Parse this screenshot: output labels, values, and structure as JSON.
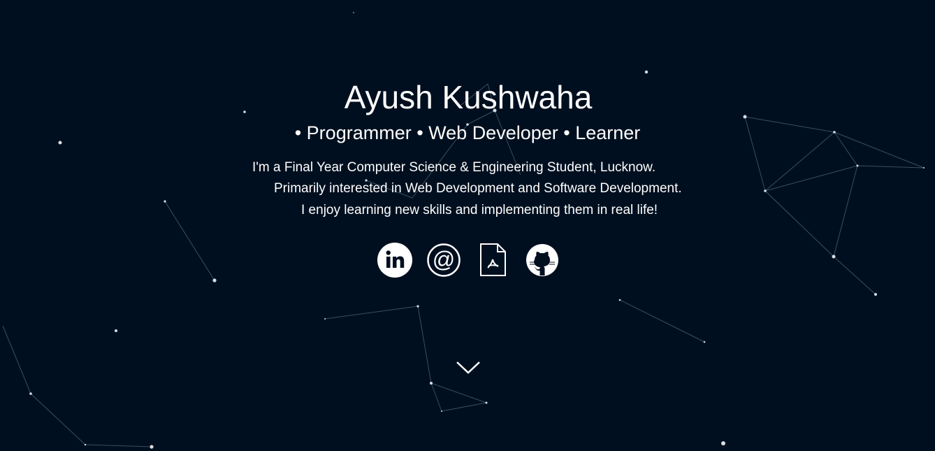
{
  "hero": {
    "name": "Ayush Kushwaha",
    "roles": "• Programmer • Web Developer • Learner",
    "bio": [
      "I'm a Final Year Computer Science & Engineering Student, Lucknow.",
      "Primarily interested in Web Development and Software Development.",
      "I enjoy learning new skills and implementing them in real life!"
    ]
  },
  "social": [
    {
      "icon": "linkedin-icon"
    },
    {
      "icon": "email-at-icon"
    },
    {
      "icon": "pdf-resume-icon"
    },
    {
      "icon": "github-icon"
    }
  ],
  "scroll": {
    "icon": "chevron-down-icon"
  },
  "colors": {
    "background": "#000f1f",
    "foreground": "#ffffff"
  }
}
